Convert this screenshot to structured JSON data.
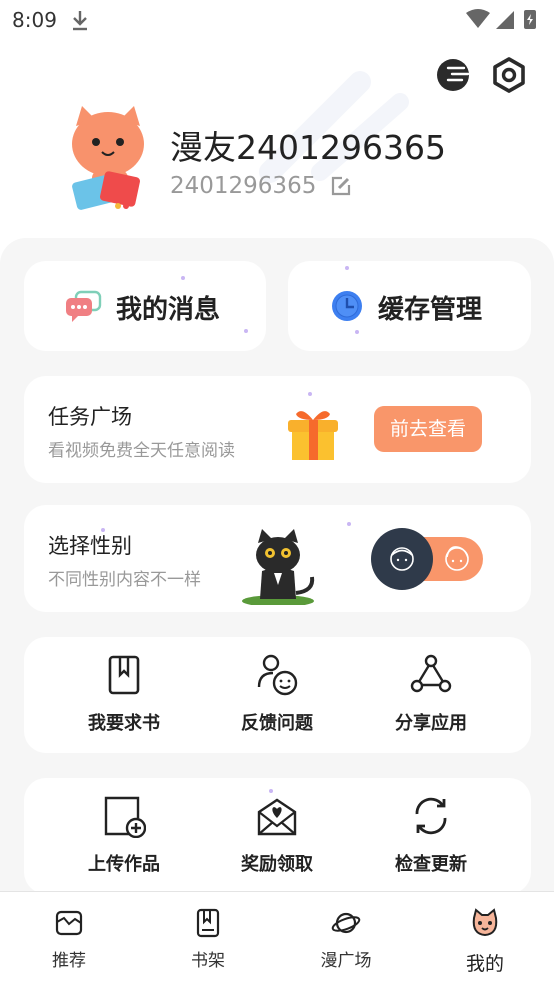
{
  "status_bar": {
    "time": "8:09"
  },
  "profile": {
    "nickname": "漫友2401296365",
    "uid": "2401296365"
  },
  "quick": {
    "messages_label": "我的消息",
    "cache_label": "缓存管理"
  },
  "task": {
    "title": "任务广场",
    "subtitle": "看视频免费全天任意阅读",
    "button_label": "前去查看"
  },
  "gender": {
    "title": "选择性别",
    "subtitle": "不同性别内容不一样"
  },
  "tools_row1": [
    {
      "label": "我要求书",
      "icon": "book-request-icon"
    },
    {
      "label": "反馈问题",
      "icon": "feedback-icon"
    },
    {
      "label": "分享应用",
      "icon": "share-icon"
    }
  ],
  "tools_row2": [
    {
      "label": "上传作品",
      "icon": "upload-icon"
    },
    {
      "label": "奖励领取",
      "icon": "reward-icon"
    },
    {
      "label": "检查更新",
      "icon": "refresh-icon"
    }
  ],
  "nav": [
    {
      "label": "推荐",
      "icon": "recommend-icon"
    },
    {
      "label": "书架",
      "icon": "bookshelf-icon"
    },
    {
      "label": "漫广场",
      "icon": "planet-icon"
    },
    {
      "label": "我的",
      "icon": "cat-face-icon",
      "active": true
    }
  ],
  "colors": {
    "accent": "#f9966a",
    "dark": "#2f3a4a",
    "clock_blue": "#3d7ff0"
  }
}
